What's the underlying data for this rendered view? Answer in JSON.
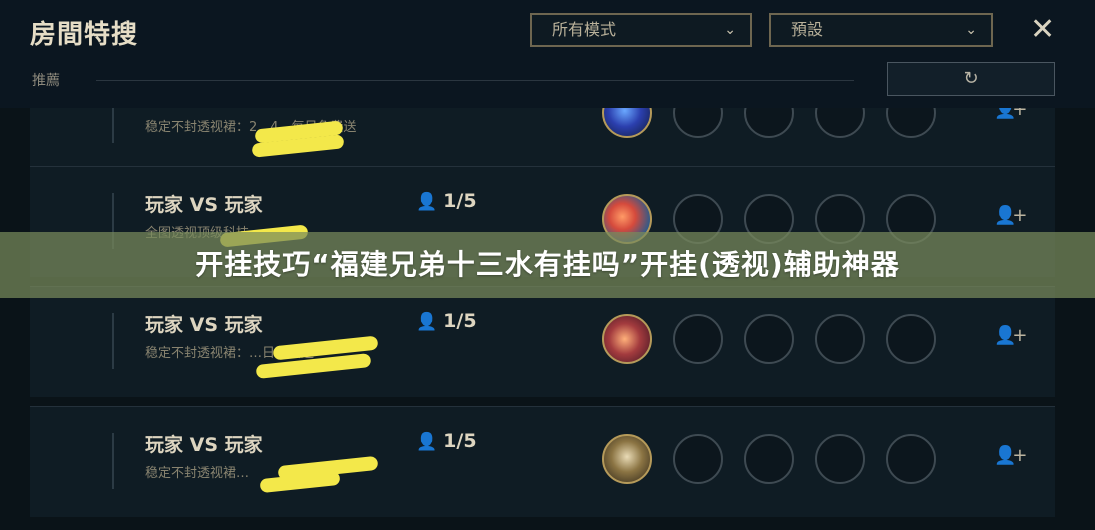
{
  "header": {
    "title": "房間特搜",
    "mode_dropdown": "所有模式",
    "preset_dropdown": "預設",
    "recommend_label": "推薦",
    "refresh_icon": "refresh-icon",
    "close_icon": "close-icon"
  },
  "rooms": [
    {
      "name": "",
      "count": "",
      "description": "稳定不封透视裙：2…4，每日免费送"
    },
    {
      "name": "玩家 VS 玩家",
      "count": "1/5",
      "description": "全图透视顶级科技"
    },
    {
      "name": "玩家 VS 玩家",
      "count": "1/5",
      "description": "稳定不封透视裙：…日免费送"
    },
    {
      "name": "玩家 VS 玩家",
      "count": "1/5",
      "description": "稳定不封透视裙…"
    }
  ],
  "banner": {
    "text": "开挂技巧“福建兄弟十三水有挂吗”开挂(透视)辅助神器"
  },
  "colors": {
    "background": "#0a1318",
    "gold_border": "#6e6650",
    "banner_bg": "#788a5c",
    "scribble": "#f3e84a"
  }
}
